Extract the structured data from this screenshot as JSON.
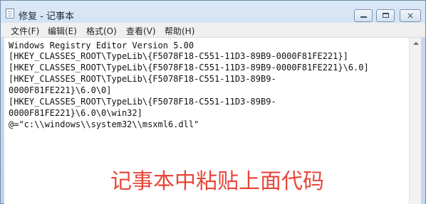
{
  "window": {
    "title": "修复 - 记事本",
    "controls": {
      "minimize": "minimize",
      "maximize": "maximize",
      "close": "×"
    }
  },
  "menu": {
    "items": [
      "文件(F)",
      "编辑(E)",
      "格式(O)",
      "查看(V)",
      "帮助(H)"
    ]
  },
  "document": {
    "lines": [
      "Windows Registry Editor Version 5.00",
      "[HKEY_CLASSES_ROOT\\TypeLib\\{F5078F18-C551-11D3-89B9-0000F81FE221}]",
      "[HKEY_CLASSES_ROOT\\TypeLib\\{F5078F18-C551-11D3-89B9-0000F81FE221}\\6.0]",
      "[HKEY_CLASSES_ROOT\\TypeLib\\{F5078F18-C551-11D3-89B9-",
      "0000F81FE221}\\6.0\\0]",
      "[HKEY_CLASSES_ROOT\\TypeLib\\{F5078F18-C551-11D3-89B9-",
      "0000F81FE221}\\6.0\\0\\win32]",
      "@=\"c:\\\\windows\\\\system32\\\\msxml6.dll\""
    ]
  },
  "annotation": {
    "text": "记事本中粘贴上面代码",
    "color": "#e8473a"
  }
}
